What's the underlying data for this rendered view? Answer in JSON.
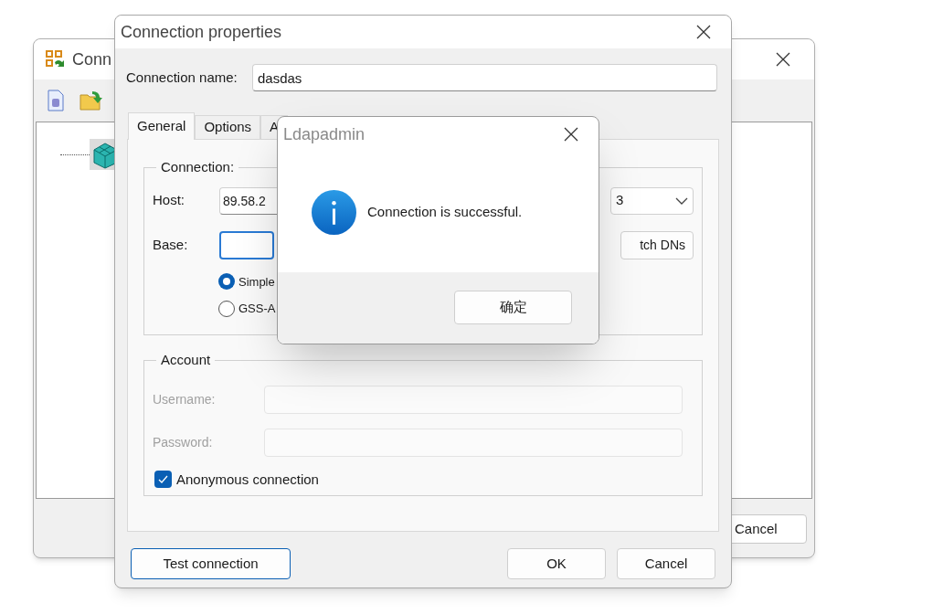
{
  "background_window": {
    "title": "Conn",
    "buttons": [
      "Cancel"
    ]
  },
  "properties_window": {
    "title": "Connection properties",
    "connection_name": {
      "label": "Connection name:",
      "value": "dasdas"
    },
    "tabs": [
      {
        "label": "General",
        "selected": true
      },
      {
        "label": "Options",
        "selected": false
      },
      {
        "label": "A",
        "selected": false
      }
    ],
    "connection_group": {
      "title": "Connection:",
      "host": {
        "label": "Host:",
        "value": "89.58.2"
      },
      "version": {
        "value": "3"
      },
      "base": {
        "label": "Base:",
        "focused": true
      },
      "fetch_button": "tch DNs",
      "auth": [
        {
          "label": "Simple",
          "selected": true
        },
        {
          "label": "GSS-A",
          "selected": false
        }
      ]
    },
    "account_group": {
      "title": "Account",
      "disabled": true,
      "fields": [
        {
          "label": "Username:"
        },
        {
          "label": "Password:"
        }
      ],
      "anonymous": {
        "label": "Anonymous connection",
        "checked": true
      }
    },
    "buttons": [
      {
        "label": "Test connection",
        "default": true
      },
      {
        "label": "OK",
        "default": false
      },
      {
        "label": "Cancel",
        "default": false
      }
    ]
  },
  "message_box": {
    "title": "Ldapadmin",
    "message": "Connection is successful.",
    "button": "确定"
  }
}
